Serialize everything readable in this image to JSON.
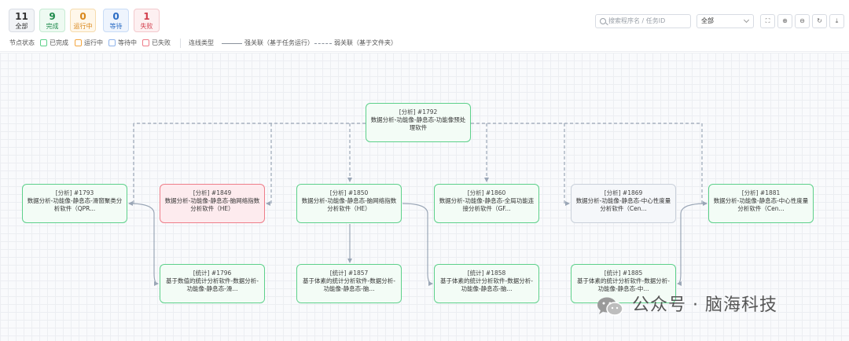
{
  "stats": [
    {
      "value": "11",
      "label": "全部"
    },
    {
      "value": "9",
      "label": "完成"
    },
    {
      "value": "0",
      "label": "运行中"
    },
    {
      "value": "0",
      "label": "等待"
    },
    {
      "value": "1",
      "label": "失败"
    }
  ],
  "search": {
    "placeholder": "搜索程序名 / 任务ID"
  },
  "filter": {
    "selected": "全部"
  },
  "toolbar": {
    "fit": "⛶",
    "zoom_in": "⊕",
    "zoom_out": "⊖",
    "refresh": "↻",
    "download": "⤓"
  },
  "legend": {
    "status_title": "节点状态",
    "status_done": "已完成",
    "status_running": "运行中",
    "status_waiting": "等待中",
    "status_failed": "已失败",
    "link_title": "连线类型",
    "strong": "强关联（基于任务运行）",
    "weak": "弱关联（基于文件夹）"
  },
  "colors": {
    "done": "#5dd08a",
    "running": "#f3a640",
    "waiting": "#8fb3ea",
    "failed": "#ee7d89",
    "edge": "#9aa6b6"
  },
  "nodes": [
    {
      "head": "[分析]  #1792",
      "text": "数据分析-功能像-静息态-功能像预处理软件",
      "status": "done"
    },
    {
      "head": "[分析]  #1793",
      "text": "数据分析-功能像-静息态-滑窗聚类分析软件（QPR...",
      "status": "done"
    },
    {
      "head": "[分析]  #1849",
      "text": "数据分析-功能像-静息态-脑网络指数分析软件（HE）",
      "status": "failed"
    },
    {
      "head": "[分析]  #1850",
      "text": "数据分析-功能像-静息态-脑网络指数分析软件（HE）",
      "status": "done"
    },
    {
      "head": "[分析]  #1860",
      "text": "数据分析-功能像-静息态-全局功能连接分析软件（GF...",
      "status": "done"
    },
    {
      "head": "[分析]  #1869",
      "text": "数据分析-功能像-静息态-中心性度量分析软件（Cen...",
      "status": "waiting"
    },
    {
      "head": "[分析]  #1881",
      "text": "数据分析-功能像-静息态-中心性度量分析软件（Cen...",
      "status": "done"
    },
    {
      "head": "[统计]  #1796",
      "text": "基于数值的统计分析软件-数据分析-功能像-静息态-滑...",
      "status": "done"
    },
    {
      "head": "[统计]  #1857",
      "text": "基于体素的统计分析软件-数据分析-功能像-静息态-脑...",
      "status": "done"
    },
    {
      "head": "[统计]  #1858",
      "text": "基于体素的统计分析软件-数据分析-功能像-静息态-脑...",
      "status": "done"
    },
    {
      "head": "[统计]  #1885",
      "text": "基于体素的统计分析软件-数据分析-功能像-静息态-中...",
      "status": "done"
    }
  ],
  "watermark": {
    "text": "公众号 · 脑海科技",
    "icon": "wechat-icon"
  }
}
